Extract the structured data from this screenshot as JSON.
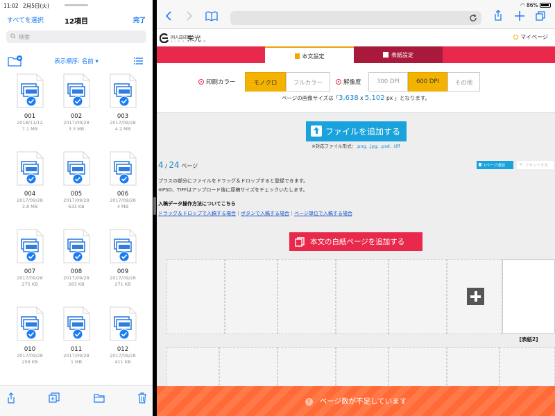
{
  "left": {
    "status_time": "11:02",
    "status_date": "2月5日(火)",
    "select_all": "すべてを選択",
    "items_count": "12項目",
    "done": "完了",
    "search_placeholder": "検索",
    "sort_label": "表示順序: 名前 ▾",
    "files": [
      {
        "name": "001",
        "date": "2018/11/12",
        "size": "7.1 MB"
      },
      {
        "name": "002",
        "date": "2017/09/28",
        "size": "3.3 MB"
      },
      {
        "name": "003",
        "date": "2017/09/28",
        "size": "4.2 MB"
      },
      {
        "name": "004",
        "date": "2017/09/28",
        "size": "3.8 MB"
      },
      {
        "name": "005",
        "date": "2017/09/28",
        "size": "633 KB"
      },
      {
        "name": "006",
        "date": "2017/09/28",
        "size": "4 MB"
      },
      {
        "name": "007",
        "date": "2017/09/28",
        "size": "275 KB"
      },
      {
        "name": "008",
        "date": "2017/09/28",
        "size": "283 KB"
      },
      {
        "name": "009",
        "date": "2017/09/28",
        "size": "271 KB"
      },
      {
        "name": "010",
        "date": "2017/09/28",
        "size": "209 KB"
      },
      {
        "name": "011",
        "date": "2017/09/28",
        "size": "1 MB"
      },
      {
        "name": "012",
        "date": "2017/09/28",
        "size": "411 KB"
      }
    ],
    "bottom_icons": [
      "share-icon",
      "duplicate-icon",
      "folder-icon",
      "trash-icon"
    ]
  },
  "right": {
    "status_battery": "86%",
    "logo_sub": "同人誌印刷",
    "logo_main": "栄光",
    "logo_url": "e i k o u . c o m",
    "mypage": "マイページ",
    "tab_body": "本文設定",
    "tab_cover": "表紙設定",
    "print_color_label": "印刷カラー",
    "print_color_options": [
      "モノクロ",
      "フルカラー"
    ],
    "resolution_label": "解像度",
    "resolution_options": [
      "300 DPI",
      "600 DPI",
      "その他"
    ],
    "image_size_prefix": "ページの画像サイズは「",
    "image_width": "3,638",
    "image_size_x": " x ",
    "image_height": "5,102",
    "image_size_suffix": " px 」となります。",
    "add_file": "ファイルを追加する",
    "formats_prefix": "※対応ファイル形式：",
    "formats_list": ".png, .jpg, .psd, .tiff",
    "page_current": "4",
    "page_sep": " / ",
    "page_total": "24",
    "page_unit": " ページ",
    "add_one_page": "1ページ追加",
    "reset": "リセットする",
    "desc_line1": "プラスの部分にファイルをドラッグ＆ドロップすると登録できます。",
    "desc_line2": "※PSD、TIFFはアップロード後に原稿サイズをチェックいたします。",
    "howto_title": "入稿データ操作方法についてこちら",
    "link_drag": "ドラッグ＆ドロップで入稿する場合",
    "link_button": "ボタンで入稿する場合",
    "link_page": "ページ単位で入稿する場合",
    "link_sep": "｜",
    "add_blank": "本文の白紙ページを追加する",
    "cover_label": "[表紙2]",
    "warning": "ページ数が不足しています"
  },
  "colors": {
    "accent_blue": "#1a7cf3",
    "brand_red": "#e8294c",
    "brand_dark_red": "#a8193b",
    "selected_yellow": "#f5b301",
    "button_blue": "#1aa2dc",
    "warning_orange": "#ff6a36"
  }
}
